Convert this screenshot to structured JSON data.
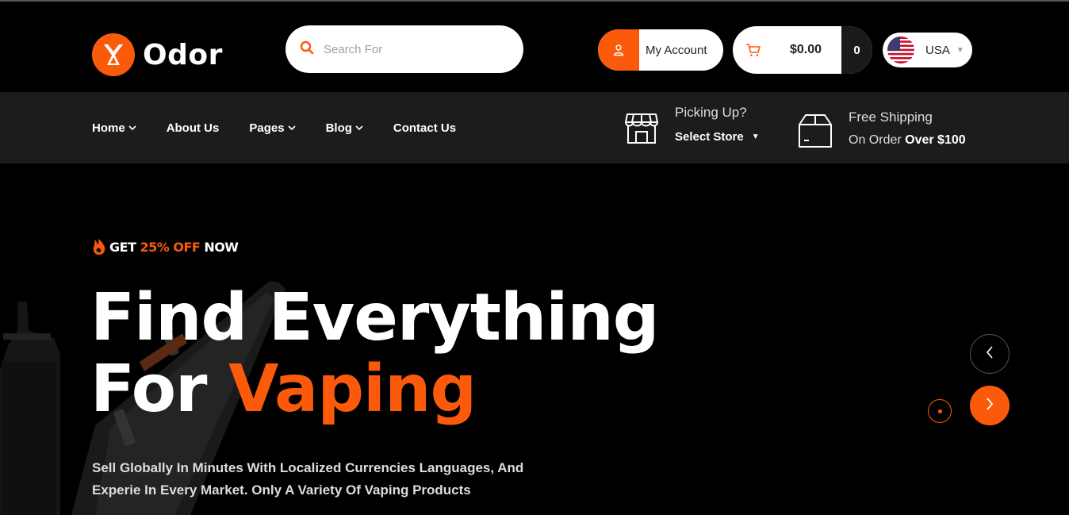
{
  "brand": {
    "name": "Odor",
    "accent": "#fc5a0b",
    "icon": "odor-logo-icon"
  },
  "search": {
    "placeholder": "Search For",
    "icon": "search-icon"
  },
  "account": {
    "label": "My Account",
    "icon": "user-icon"
  },
  "cart": {
    "total": "$0.00",
    "count": "0",
    "icon": "cart-icon"
  },
  "country": {
    "label": "USA",
    "flag": "us-flag-icon"
  },
  "nav": {
    "items": [
      {
        "label": "Home",
        "has_dropdown": true
      },
      {
        "label": "About Us",
        "has_dropdown": false
      },
      {
        "label": "Pages",
        "has_dropdown": true
      },
      {
        "label": "Blog",
        "has_dropdown": true
      },
      {
        "label": "Contact Us",
        "has_dropdown": false
      }
    ]
  },
  "pickup": {
    "title": "Picking Up?",
    "select_label": "Select Store",
    "icon": "store-icon"
  },
  "shipping": {
    "title": "Free Shipping",
    "sub_prefix": "On Order",
    "sub_highlight": "Over $100",
    "icon": "box-icon"
  },
  "hero": {
    "promo_prefix": "GET",
    "promo_accent": "25% OFF",
    "promo_suffix": "NOW",
    "headline_line1": "Find Everything",
    "headline_line2_prefix": "For",
    "headline_line2_accent": "Vaping",
    "description_line1": "Sell Globally In Minutes With Localized Currencies Languages, And",
    "description_line2": "Experie In Every Market. Only A Variety Of Vaping Products"
  },
  "slider": {
    "prev_icon": "chevron-left-icon",
    "next_icon": "chevron-right-icon"
  }
}
